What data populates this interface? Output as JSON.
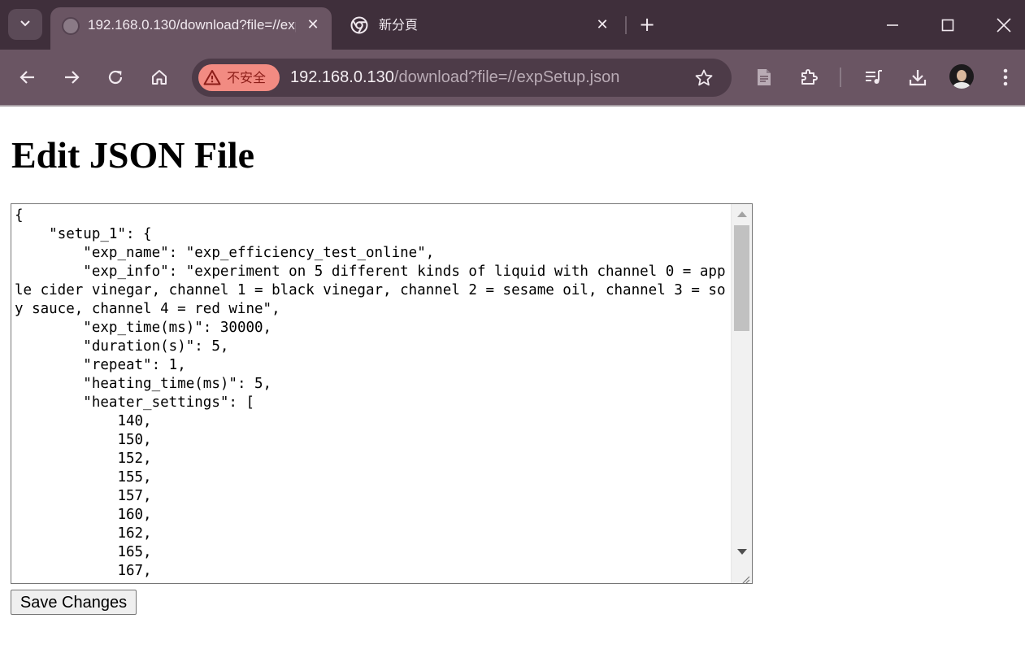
{
  "browser": {
    "tabs": [
      {
        "title": "192.168.0.130/download?file=//expSetup.json",
        "active": true
      },
      {
        "title": "新分頁",
        "active": false
      }
    ],
    "address_bar": {
      "security_label": "不安全",
      "url_host": "192.168.0.130",
      "url_path": "/download?file=//expSetup.json"
    },
    "colors": {
      "frame": "#3f2f3b",
      "toolbar": "#6a5563",
      "insecure_chip": "#f28b82"
    }
  },
  "page": {
    "title": "Edit JSON File",
    "json_text": "{\n    \"setup_1\": {\n        \"exp_name\": \"exp_efficiency_test_online\",\n        \"exp_info\": \"experiment on 5 different kinds of liquid with channel 0 = apple cider vinegar, channel 1 = black vinegar, channel 2 = sesame oil, channel 3 = soy sauce, channel 4 = red wine\",\n        \"exp_time(ms)\": 30000,\n        \"duration(s)\": 5,\n        \"repeat\": 1,\n        \"heating_time(ms)\": 5,\n        \"heater_settings\": [\n            140,\n            150,\n            152,\n            155,\n            157,\n            160,\n            162,\n            165,\n            167,",
    "save_label": "Save Changes"
  }
}
